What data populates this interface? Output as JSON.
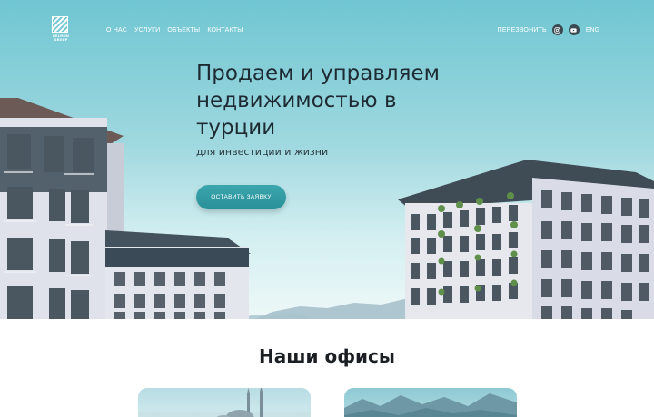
{
  "header": {
    "logo": {
      "brand_lines": [
        "HELMON",
        "GROUP"
      ]
    },
    "nav": [
      {
        "label": "О НАС"
      },
      {
        "label": "УСЛУГИ"
      },
      {
        "label": "ОБЪЕКТЫ"
      },
      {
        "label": "КОНТАКТЫ"
      }
    ],
    "callback_label": "ПЕРЕЗВОНИТЬ",
    "social_icons": [
      "instagram-icon",
      "youtube-icon"
    ],
    "lang_label": "ENG"
  },
  "hero": {
    "headline": "Продаем и управляем недвижимостью в турции",
    "subtitle": "для инвестиции и жизни",
    "cta_label": "ОСТАВИТЬ ЗАЯВКУ"
  },
  "offices": {
    "title": "Наши офисы"
  },
  "colors": {
    "accent": "#2f9aa2",
    "heading": "#1e2b33",
    "sky_top": "#6fc6d2"
  }
}
